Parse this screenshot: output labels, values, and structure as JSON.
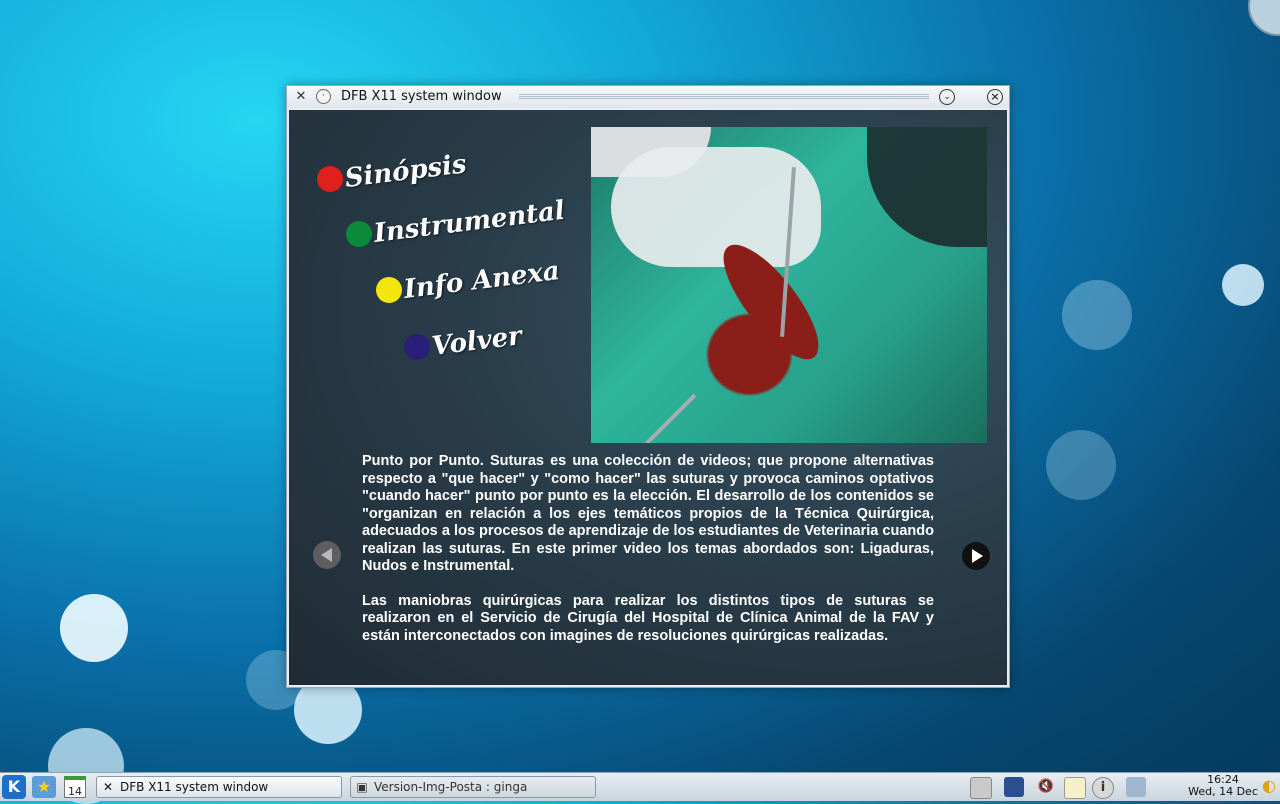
{
  "window": {
    "title": "DFB X11 system window",
    "icons": [
      "x11-app-icon",
      "pin-icon",
      "minimize-icon",
      "close-icon"
    ]
  },
  "menu": {
    "items": [
      {
        "label": "Sinópsis",
        "color": "#e0201c"
      },
      {
        "label": "Instrumental",
        "color": "#0b8a3a"
      },
      {
        "label": "Info Anexa",
        "color": "#f4e60b"
      },
      {
        "label": "Volver",
        "color": "#2a1f78"
      }
    ]
  },
  "description": {
    "paragraph1": "Punto por Punto. Suturas es una colección de videos; que propone alternativas respecto a \"que hacer\" y \"como hacer\" las suturas y provoca caminos optativos \"cuando hacer\" punto por punto es la elección. El desarrollo de los contenidos se \"organizan en relación a los ejes temáticos propios de la Técnica Quirúrgica, adecuados a los procesos de aprendizaje de los estudiantes de Veterinaria cuando realizan las suturas. En este primer video los temas abordados son: Ligaduras, Nudos e Instrumental.",
    "paragraph2": "Las maniobras quirúrgicas para realizar los distintos tipos de suturas se realizaron en el Servicio de Cirugía del Hospital de Clínica Animal de la FAV y están interconectados con imagines de resoluciones quirúrgicas realizadas."
  },
  "taskbar": {
    "calendar_day": "14",
    "tasks": [
      {
        "label": "DFB X11 system window",
        "icon": "x11-app-icon"
      },
      {
        "label": "Version-Img-Posta : ginga",
        "icon": "terminal-icon"
      }
    ],
    "clock_time": "16:24",
    "clock_date": "Wed, 14 Dec"
  }
}
